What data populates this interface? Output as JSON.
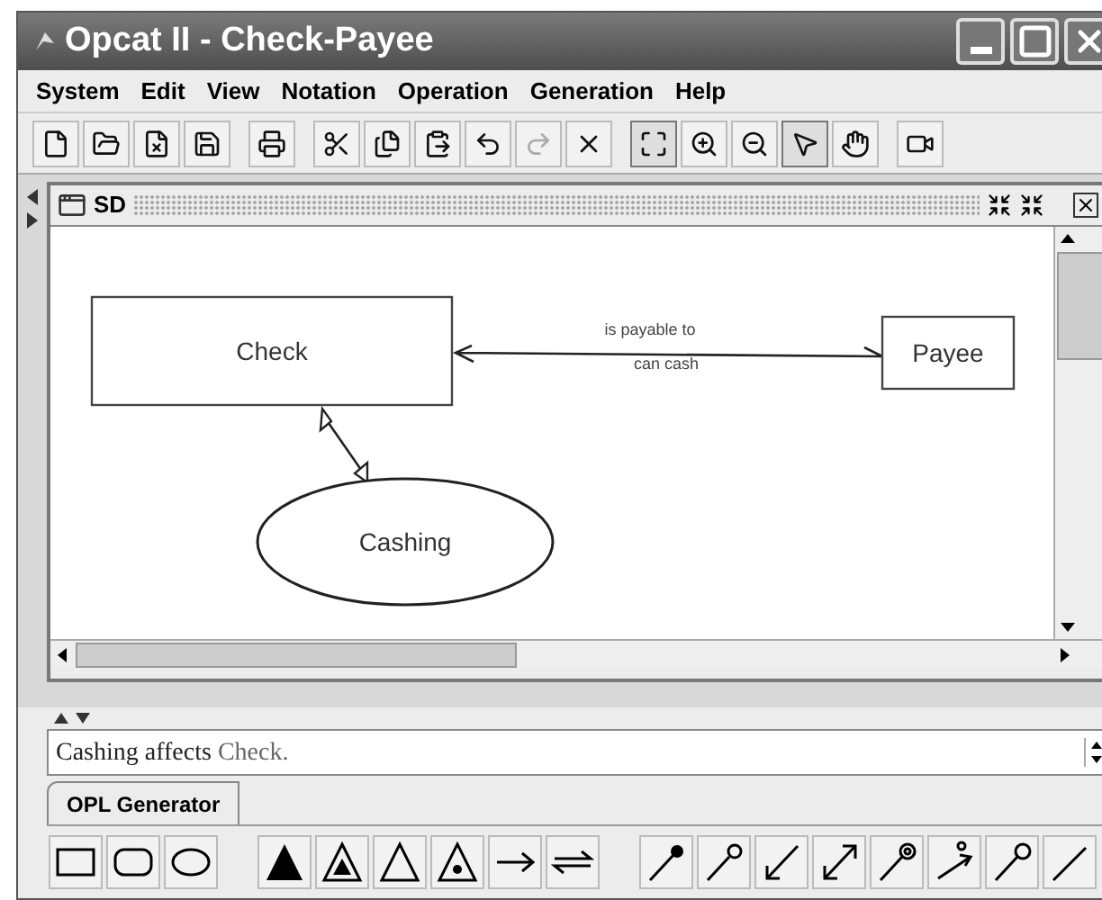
{
  "window": {
    "title": "Opcat II - Check-Payee"
  },
  "menu": [
    "System",
    "Edit",
    "View",
    "Notation",
    "Operation",
    "Generation",
    "Help"
  ],
  "toolbar": [
    [
      {
        "kind": "new",
        "selected": false,
        "disabled": false
      },
      {
        "kind": "open",
        "selected": false,
        "disabled": false
      },
      {
        "kind": "close",
        "selected": false,
        "disabled": false
      },
      {
        "kind": "save",
        "selected": false,
        "disabled": false
      }
    ],
    [
      {
        "kind": "print",
        "selected": false,
        "disabled": false
      }
    ],
    [
      {
        "kind": "cut",
        "selected": false,
        "disabled": false
      },
      {
        "kind": "copy",
        "selected": false,
        "disabled": false
      },
      {
        "kind": "paste",
        "selected": false,
        "disabled": false
      },
      {
        "kind": "undo",
        "selected": false,
        "disabled": false
      },
      {
        "kind": "redo",
        "selected": false,
        "disabled": true
      },
      {
        "kind": "delete",
        "selected": false,
        "disabled": false
      }
    ],
    [
      {
        "kind": "fit",
        "selected": true,
        "disabled": false
      },
      {
        "kind": "zoom-in",
        "selected": false,
        "disabled": false
      },
      {
        "kind": "zoom-out",
        "selected": false,
        "disabled": false
      },
      {
        "kind": "pointer",
        "selected": true,
        "disabled": false
      },
      {
        "kind": "hand",
        "selected": false,
        "disabled": false
      }
    ],
    [
      {
        "kind": "camera",
        "selected": false,
        "disabled": false
      }
    ]
  ],
  "diagram": {
    "title": "SD",
    "nodes": [
      {
        "kind": "object",
        "label": "Check"
      },
      {
        "kind": "object",
        "label": "Payee"
      },
      {
        "kind": "process",
        "label": "Cashing"
      }
    ],
    "links": [
      {
        "kind": "bidirectional",
        "tag": "is payable to",
        "backward_tag": "can cash"
      },
      {
        "kind": "effect"
      }
    ]
  },
  "opl": [
    {
      "kind": "process",
      "text": "Cashing affects"
    },
    {
      "kind": "object",
      "text": "Check."
    }
  ],
  "tabs": [
    {
      "label": "OPL Generator",
      "selected": true
    }
  ],
  "palette": [
    [
      {
        "kind": "object"
      },
      {
        "kind": "process-rounded"
      },
      {
        "kind": "process"
      }
    ],
    [
      {
        "kind": "aggregation"
      },
      {
        "kind": "exhibition"
      },
      {
        "kind": "generalization"
      },
      {
        "kind": "instantiation"
      },
      {
        "kind": "unidirectional"
      },
      {
        "kind": "bidirectional"
      }
    ],
    [
      {
        "kind": "agent"
      },
      {
        "kind": "instrument"
      },
      {
        "kind": "consumption"
      },
      {
        "kind": "effect"
      },
      {
        "kind": "event"
      },
      {
        "kind": "invocation"
      },
      {
        "kind": "condition"
      },
      {
        "kind": "cut"
      }
    ]
  ]
}
